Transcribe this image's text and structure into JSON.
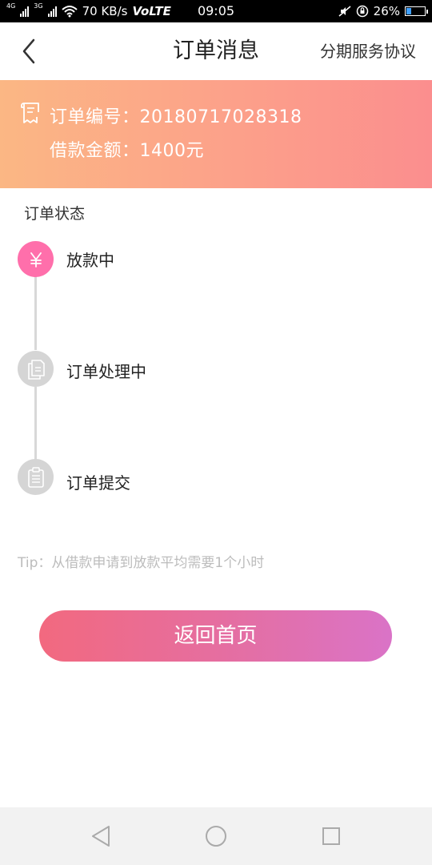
{
  "status_bar": {
    "network_left": "4G",
    "network_right": "3G",
    "speed": "70 KB/s",
    "volte": "VoLTE",
    "time": "09:05",
    "battery": "26%",
    "battery_level": 0.26
  },
  "nav": {
    "title": "订单消息",
    "right_link": "分期服务协议"
  },
  "order": {
    "number_label": "订单编号：",
    "number": "20180717028318",
    "amount_label": "借款金额：",
    "amount": "1400元"
  },
  "status": {
    "section_title": "订单状态",
    "steps": [
      {
        "label": "放款中",
        "icon": "yen-icon",
        "state": "active"
      },
      {
        "label": "订单处理中",
        "icon": "documents-icon",
        "state": "inactive"
      },
      {
        "label": "订单提交",
        "icon": "clipboard-icon",
        "state": "inactive"
      }
    ]
  },
  "tip": "Tip：从借款申请到放款平均需要1个小时",
  "home_button": "返回首页",
  "colors": {
    "banner_start": "#fbb784",
    "banner_end": "#fb8e8e",
    "active_step": "#ff6fab",
    "inactive_step": "#d5d5d5",
    "button_start": "#f2697f",
    "button_end": "#da73c7"
  }
}
